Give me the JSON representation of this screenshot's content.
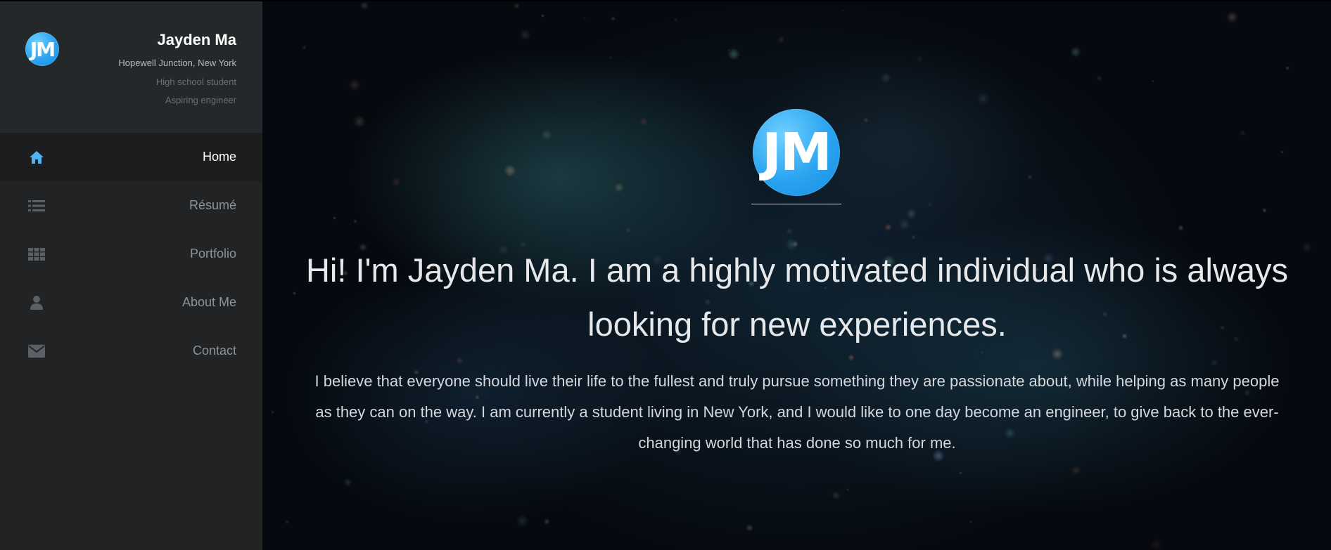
{
  "sidebar": {
    "logo_text": "JM",
    "name": "Jayden Ma",
    "location": "Hopewell Junction, New York",
    "tagline_1": "High school student",
    "tagline_2": "Aspiring engineer",
    "items": [
      {
        "label": "Home",
        "icon": "home-icon",
        "active": true
      },
      {
        "label": "Résumé",
        "icon": "list-icon",
        "active": false
      },
      {
        "label": "Portfolio",
        "icon": "grid-icon",
        "active": false
      },
      {
        "label": "About Me",
        "icon": "user-icon",
        "active": false
      },
      {
        "label": "Contact",
        "icon": "envelope-icon",
        "active": false
      }
    ]
  },
  "hero": {
    "logo_text": "JM",
    "heading": "Hi! I'm Jayden Ma. I am a highly motivated individual who is always looking for new experiences.",
    "paragraph": "I believe that everyone should live their life to the fullest and truly pursue something they are passionate about, while helping as many people as they can on the way. I am currently a student living in New York, and I would like to one day become an engineer, to give back to the ever-changing world that has done so much for me."
  },
  "colors": {
    "accent": "#2aa3f0",
    "sidebar_bg": "#212325",
    "active_icon": "#4fb3f5",
    "inactive_icon": "#5b6066"
  }
}
